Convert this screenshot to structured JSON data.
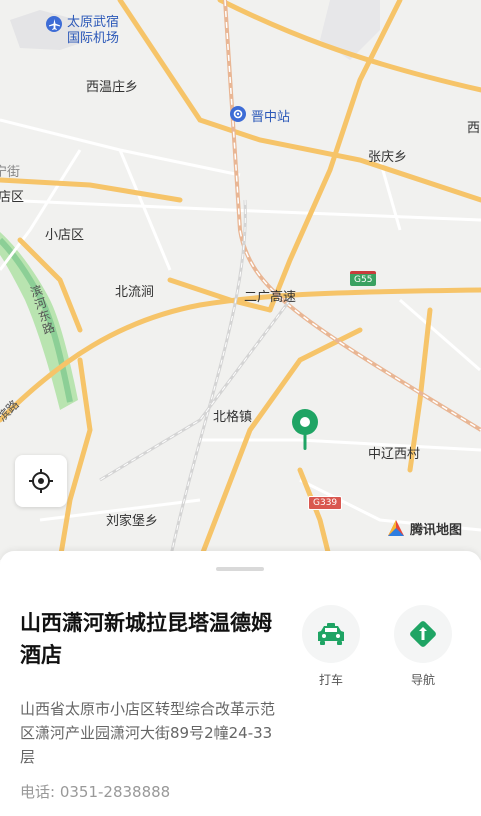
{
  "map": {
    "labels": {
      "airport_l1": "太原武宿",
      "airport_l2": "国际机场",
      "xiwenzhuang": "西温庄乡",
      "jinzhong": "晋中站",
      "xi_edge": "西",
      "zhangqing": "张庆乡",
      "jie_edge": "宁街",
      "dianqu_edge": "店区",
      "xiaodian": "小店区",
      "beiliujian": "北流涧",
      "binhe_east": "滨河东路",
      "erguang": "二广高速",
      "g55": "G55",
      "beige": "北格镇",
      "zhongliaoxi": "中辽西村",
      "binlu": "滨路",
      "g339": "G339",
      "liujiabao": "刘家堡乡"
    },
    "brand": "腾讯地图",
    "icons": {
      "airport": "airport-icon",
      "station": "train-station-icon",
      "locate": "locate-icon",
      "pin": "location-pin-icon",
      "brand_logo": "tencent-map-logo-icon"
    },
    "colors": {
      "road_major": "#f6c469",
      "road_minor": "#ffffff",
      "rail": "#e7ad8c",
      "water": "#a9dc9f",
      "pin": "#1fa464",
      "label_blue": "#2b58b8"
    }
  },
  "place": {
    "name": "山西潇河新城拉昆塔温德姆酒店",
    "address": "山西省太原市小店区转型综合改革示范区潇河产业园潇河大街89号2幢24-33层",
    "phone": "电话: 0351-2838888"
  },
  "actions": {
    "taxi_label": "打车",
    "nav_label": "导航"
  }
}
